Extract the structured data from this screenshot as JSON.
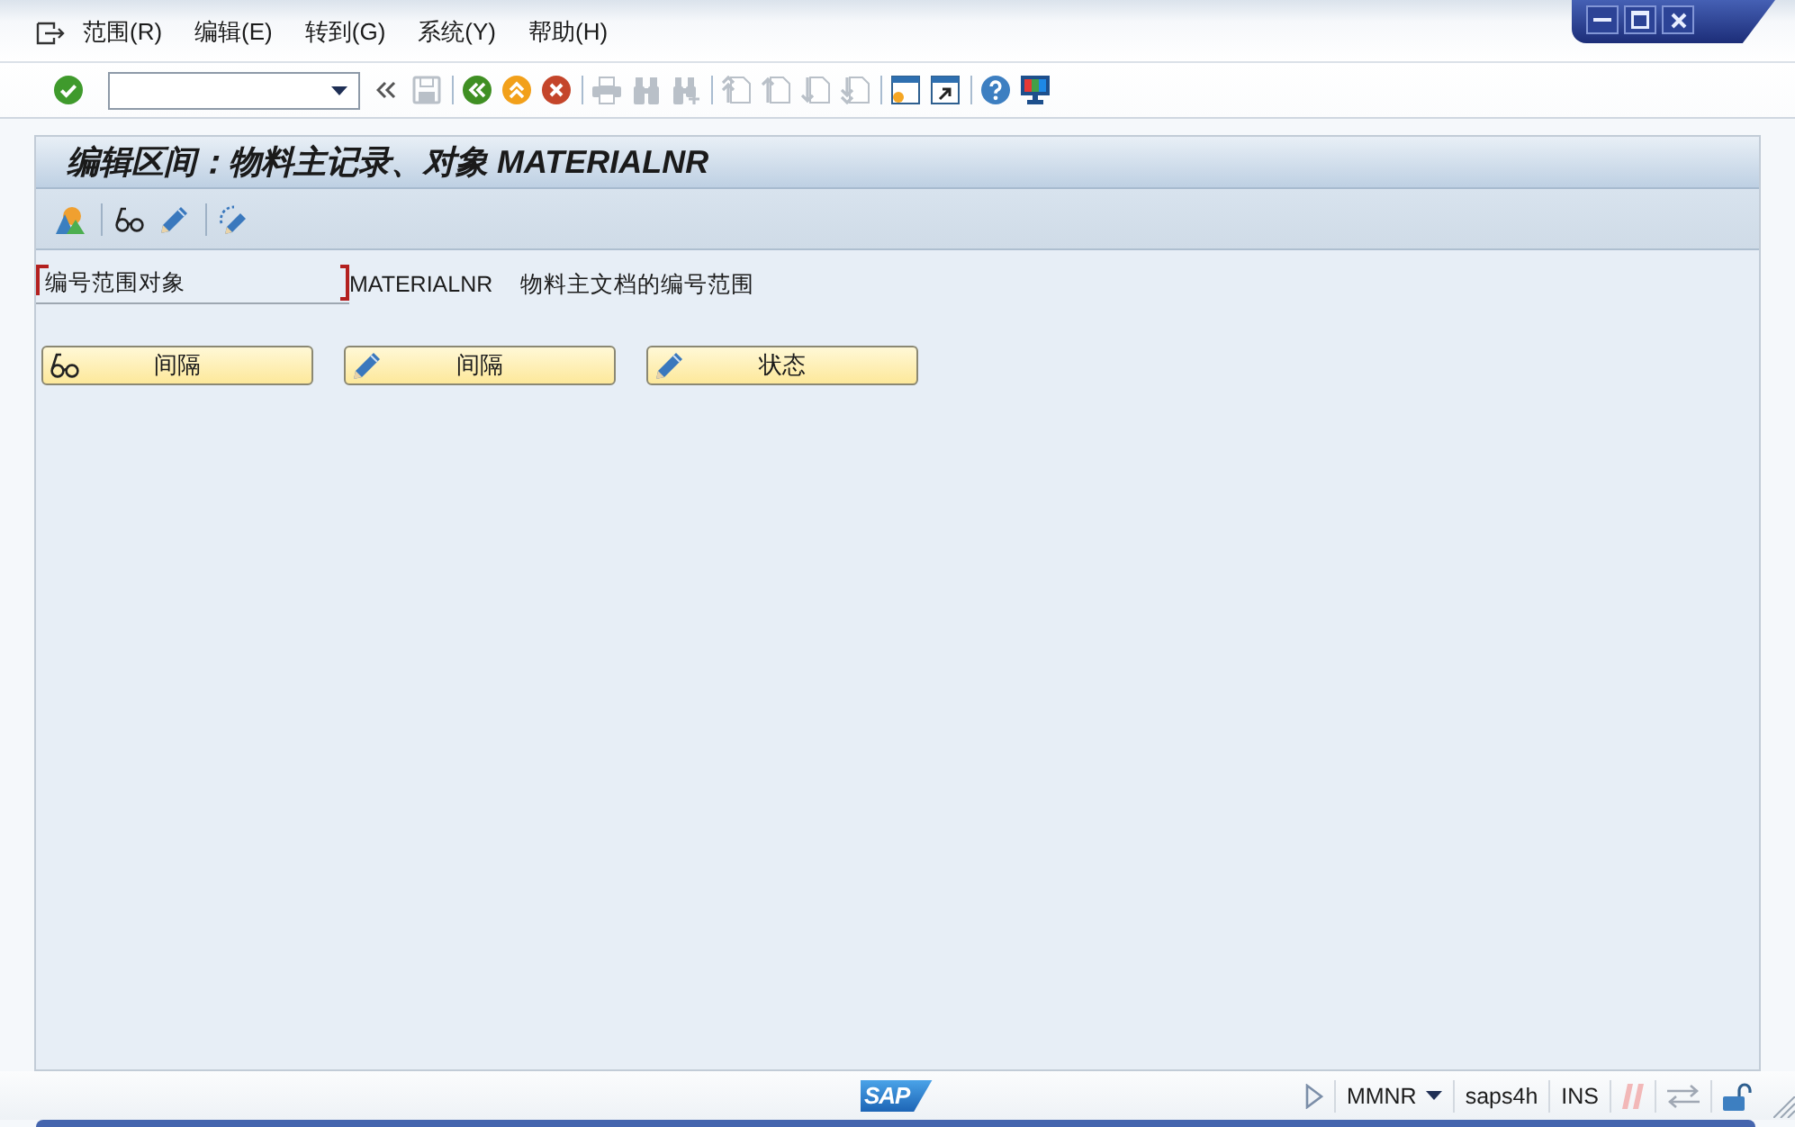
{
  "menu": [
    {
      "label": "范围(R)"
    },
    {
      "label": "编辑(E)"
    },
    {
      "label": "转到(G)"
    },
    {
      "label": "系统(Y)"
    },
    {
      "label": "帮助(H)"
    }
  ],
  "toolbar": {
    "groups": [
      [
        {
          "kind": "enter",
          "disabled": false
        },
        {
          "kind": "command_field",
          "disabled": false
        },
        {
          "kind": "history",
          "disabled": false
        },
        {
          "kind": "save",
          "disabled": true
        }
      ],
      [
        {
          "kind": "back",
          "disabled": false
        },
        {
          "kind": "exit",
          "disabled": false
        },
        {
          "kind": "cancel",
          "disabled": false
        }
      ],
      [
        {
          "kind": "print",
          "disabled": true
        },
        {
          "kind": "find",
          "disabled": true
        },
        {
          "kind": "find_next",
          "disabled": true
        }
      ],
      [
        {
          "kind": "first_page",
          "disabled": true
        },
        {
          "kind": "previous_page",
          "disabled": true
        },
        {
          "kind": "next_page",
          "disabled": true
        },
        {
          "kind": "last_page",
          "disabled": true
        }
      ],
      [
        {
          "kind": "new_session",
          "disabled": false
        },
        {
          "kind": "shortcut",
          "disabled": false
        }
      ],
      [
        {
          "kind": "help",
          "disabled": false
        },
        {
          "kind": "layout",
          "disabled": false
        }
      ]
    ]
  },
  "title_bar": {
    "title": "编辑区间：物料主记录、对象 MATERIALNR"
  },
  "app_toolbar": {
    "groups": [
      [
        {
          "kind": "overview"
        }
      ],
      [
        {
          "kind": "display"
        },
        {
          "kind": "change"
        }
      ],
      [
        {
          "kind": "change_status"
        }
      ]
    ]
  },
  "field": {
    "label": "编号范围对象",
    "focused": true,
    "value": "MATERIALNR",
    "description": "物料主文档的编号范围"
  },
  "buttons": [
    {
      "kind": "display",
      "label": "间隔"
    },
    {
      "kind": "change",
      "label": "间隔"
    },
    {
      "kind": "change",
      "label": "状态"
    }
  ],
  "status_bar": {
    "logo": "SAP",
    "transaction": "MMNR",
    "system": "saps4h",
    "mode": "INS"
  }
}
